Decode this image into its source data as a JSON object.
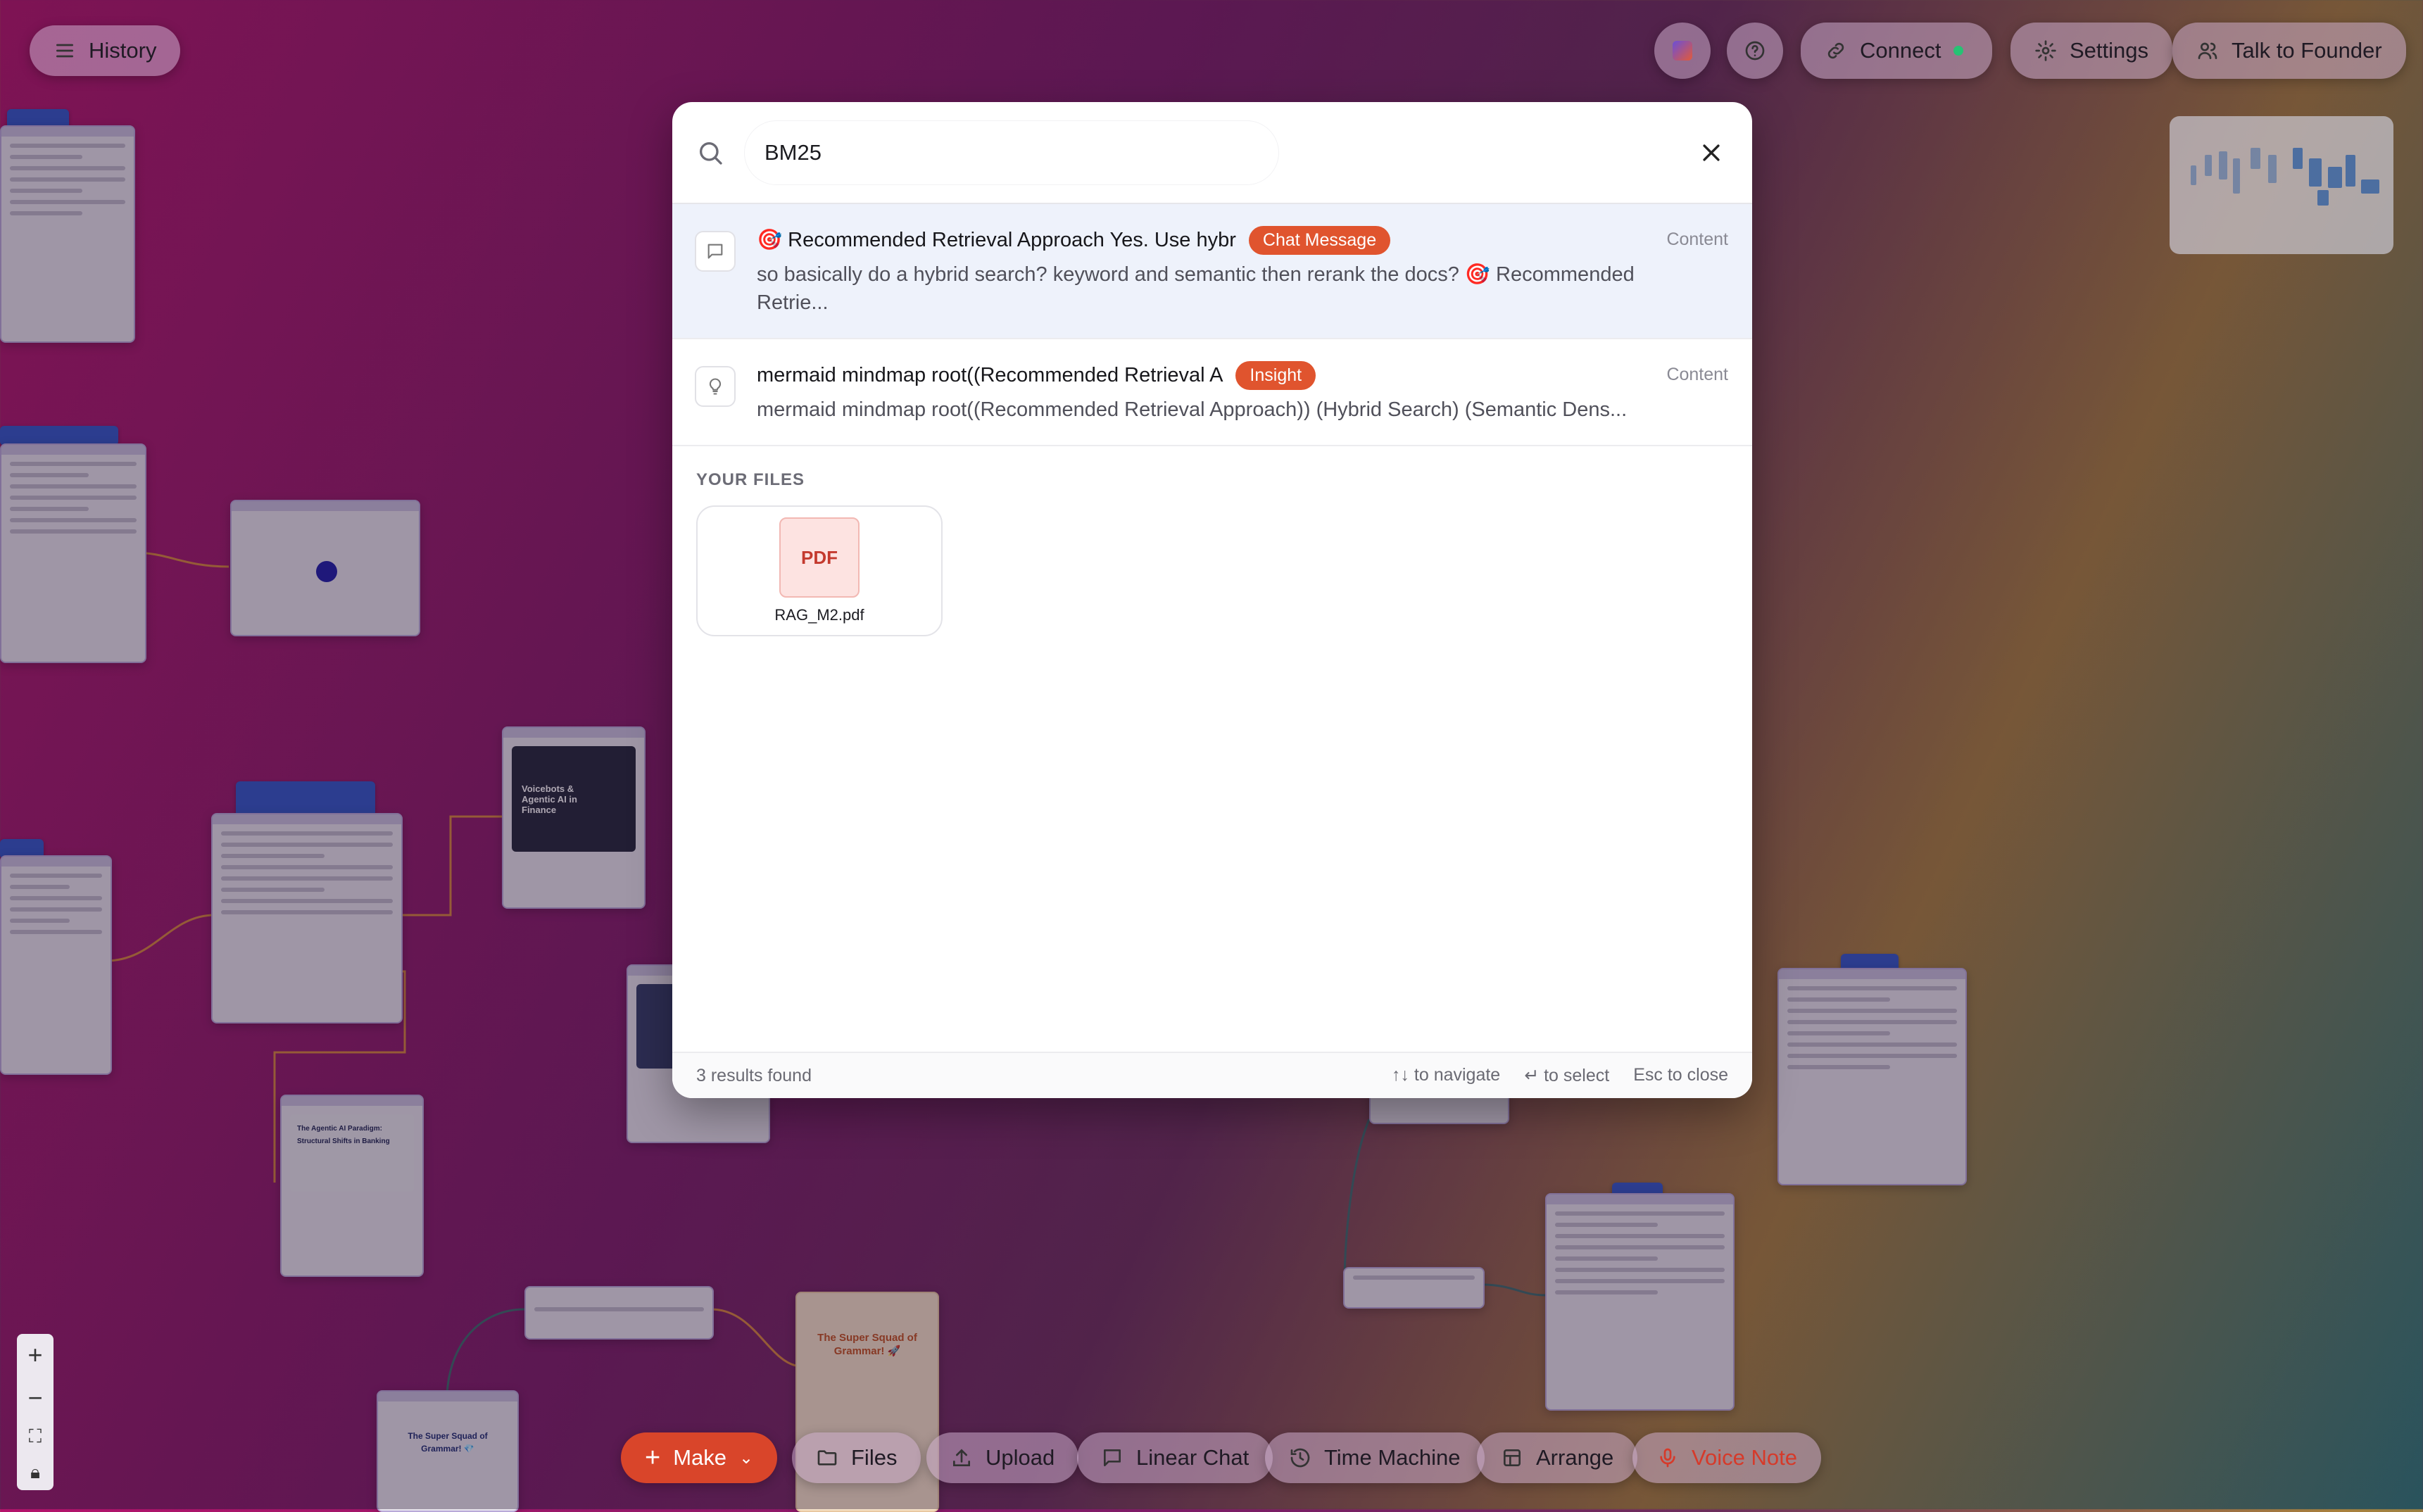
{
  "topbar": {
    "history_label": "History",
    "connect_label": "Connect",
    "settings_label": "Settings",
    "founder_label": "Talk to Founder"
  },
  "search": {
    "query": "BM25",
    "results": [
      {
        "title": "🎯 Recommended Retrieval Approach Yes. Use hybr",
        "badge": "Chat Message",
        "snippet": "so basically do a hybrid search? keyword and semantic then rerank the docs? 🎯 Recommended Retrie...",
        "category": "Content",
        "icon": "chat-bubble-icon"
      },
      {
        "title": "mermaid mindmap root((Recommended Retrieval A",
        "badge": "Insight",
        "snippet": "mermaid mindmap root((Recommended Retrieval Approach)) (Hybrid Search) (Semantic Dens...",
        "category": "Content",
        "icon": "lightbulb-icon"
      }
    ],
    "files_label": "YOUR FILES",
    "files": [
      {
        "type_label": "PDF",
        "name": "RAG_M2.pdf"
      }
    ],
    "footer": {
      "count": "3 results found",
      "navigate": "↑↓ to navigate",
      "select": "↵ to select",
      "close": "Esc to close"
    }
  },
  "canvas_text": {
    "card_finance": "Voicebots & Agentic AI in Finance",
    "card_paradigm": "The Agentic AI Paradigm: Structural Shifts in Banking",
    "card_grammar": "The Super Squad of Grammar! 🚀",
    "card_grammar2": "The Super Squad of Grammar! 💎"
  },
  "bottombar": {
    "make_label": "Make",
    "files_label": "Files",
    "upload_label": "Upload",
    "linear_chat_label": "Linear Chat",
    "time_machine_label": "Time Machine",
    "arrange_label": "Arrange",
    "voice_note_label": "Voice Note"
  },
  "colors": {
    "accent": "#e0542e",
    "selected_row": "#eef2fb",
    "status_connected": "#27c274"
  }
}
